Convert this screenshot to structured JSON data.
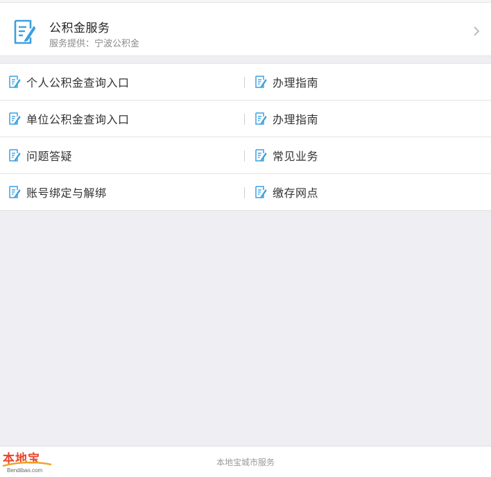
{
  "header": {
    "title": "公积金服务",
    "subtitle": "服务提供：宁波公积金",
    "icon": "document-edit-icon"
  },
  "menu": {
    "rows": [
      {
        "left": "个人公积金查询入口",
        "right": "办理指南"
      },
      {
        "left": "单位公积金查询入口",
        "right": "办理指南"
      },
      {
        "left": "问题答疑",
        "right": "常见业务"
      },
      {
        "left": "账号绑定与解绑",
        "right": "缴存网点"
      }
    ]
  },
  "footer": {
    "text": "本地宝城市服务",
    "logo_main": "本地宝",
    "logo_sub": "Bendibao.com"
  },
  "colors": {
    "icon_blue": "#3aa0e0",
    "logo_red": "#e8452a"
  }
}
